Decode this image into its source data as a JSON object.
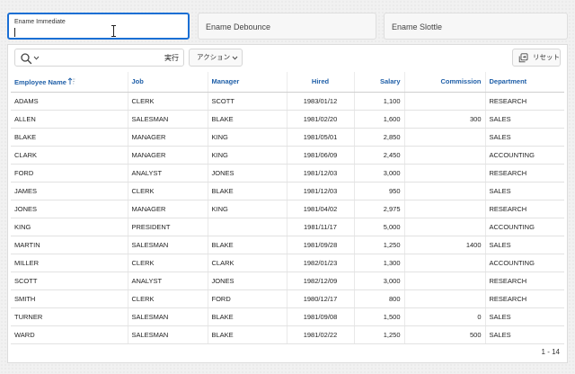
{
  "filters": {
    "immediate": {
      "label": "Ename Immediate",
      "value": ""
    },
    "debounce": {
      "placeholder": "Ename Debounce"
    },
    "throttle": {
      "placeholder": "Ename Slottle"
    }
  },
  "toolbar": {
    "search_icon": "search-icon",
    "go_label": "実行",
    "actions_label": "アクション",
    "reset_label": "リセット"
  },
  "table": {
    "columns": [
      "Employee Name",
      "Job",
      "Manager",
      "Hired",
      "Salary",
      "Commission",
      "Department"
    ],
    "rows": [
      [
        "ADAMS",
        "CLERK",
        "SCOTT",
        "1983/01/12",
        "1,100",
        "",
        "RESEARCH"
      ],
      [
        "ALLEN",
        "SALESMAN",
        "BLAKE",
        "1981/02/20",
        "1,600",
        "300",
        "SALES"
      ],
      [
        "BLAKE",
        "MANAGER",
        "KING",
        "1981/05/01",
        "2,850",
        "",
        "SALES"
      ],
      [
        "CLARK",
        "MANAGER",
        "KING",
        "1981/06/09",
        "2,450",
        "",
        "ACCOUNTING"
      ],
      [
        "FORD",
        "ANALYST",
        "JONES",
        "1981/12/03",
        "3,000",
        "",
        "RESEARCH"
      ],
      [
        "JAMES",
        "CLERK",
        "BLAKE",
        "1981/12/03",
        "950",
        "",
        "SALES"
      ],
      [
        "JONES",
        "MANAGER",
        "KING",
        "1981/04/02",
        "2,975",
        "",
        "RESEARCH"
      ],
      [
        "KING",
        "PRESIDENT",
        "",
        "1981/11/17",
        "5,000",
        "",
        "ACCOUNTING"
      ],
      [
        "MARTIN",
        "SALESMAN",
        "BLAKE",
        "1981/09/28",
        "1,250",
        "1400",
        "SALES"
      ],
      [
        "MILLER",
        "CLERK",
        "CLARK",
        "1982/01/23",
        "1,300",
        "",
        "ACCOUNTING"
      ],
      [
        "SCOTT",
        "ANALYST",
        "JONES",
        "1982/12/09",
        "3,000",
        "",
        "RESEARCH"
      ],
      [
        "SMITH",
        "CLERK",
        "FORD",
        "1980/12/17",
        "800",
        "",
        "RESEARCH"
      ],
      [
        "TURNER",
        "SALESMAN",
        "BLAKE",
        "1981/09/08",
        "1,500",
        "0",
        "SALES"
      ],
      [
        "WARD",
        "SALESMAN",
        "BLAKE",
        "1981/02/22",
        "1,250",
        "500",
        "SALES"
      ]
    ],
    "sorted_column": "Employee Name",
    "sort_direction": "ascending"
  },
  "pagination": {
    "text": "1 - 14"
  },
  "colors": {
    "accent": "#1a6fd4",
    "header_text": "#1f5fa8"
  }
}
